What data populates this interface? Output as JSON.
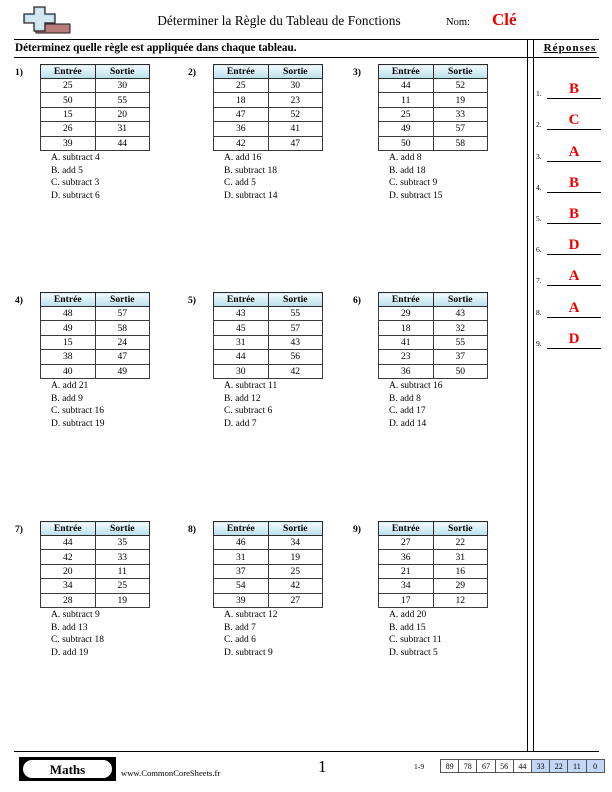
{
  "header": {
    "title": "Déterminer la Règle du Tableau de Fonctions",
    "name_label": "Nom:",
    "name_value": "Clé",
    "name_color": "#ee0000",
    "logo_icon": "plus-and-bar-logo"
  },
  "instruction": "Déterminez quelle règle est appliquée dans chaque tableau.",
  "table_headers": {
    "input": "Entrée",
    "output": "Sortie"
  },
  "questions": [
    {
      "num": "1)",
      "rows": [
        [
          "25",
          "30"
        ],
        [
          "50",
          "55"
        ],
        [
          "15",
          "20"
        ],
        [
          "26",
          "31"
        ],
        [
          "39",
          "44"
        ]
      ],
      "choices": [
        "A. subtract 4",
        "B. add 5",
        "C. subtract 3",
        "D. subtract 6"
      ]
    },
    {
      "num": "2)",
      "rows": [
        [
          "25",
          "30"
        ],
        [
          "18",
          "23"
        ],
        [
          "47",
          "52"
        ],
        [
          "36",
          "41"
        ],
        [
          "42",
          "47"
        ]
      ],
      "choices": [
        "A. add 16",
        "B. subtract 18",
        "C. add 5",
        "D. subtract 14"
      ]
    },
    {
      "num": "3)",
      "rows": [
        [
          "44",
          "52"
        ],
        [
          "11",
          "19"
        ],
        [
          "25",
          "33"
        ],
        [
          "49",
          "57"
        ],
        [
          "50",
          "58"
        ]
      ],
      "choices": [
        "A. add 8",
        "B. add 18",
        "C. subtract 9",
        "D. subtract 15"
      ]
    },
    {
      "num": "4)",
      "rows": [
        [
          "48",
          "57"
        ],
        [
          "49",
          "58"
        ],
        [
          "15",
          "24"
        ],
        [
          "38",
          "47"
        ],
        [
          "40",
          "49"
        ]
      ],
      "choices": [
        "A. add 21",
        "B. add 9",
        "C. subtract 16",
        "D. subtract 19"
      ]
    },
    {
      "num": "5)",
      "rows": [
        [
          "43",
          "55"
        ],
        [
          "45",
          "57"
        ],
        [
          "31",
          "43"
        ],
        [
          "44",
          "56"
        ],
        [
          "30",
          "42"
        ]
      ],
      "choices": [
        "A. subtract 11",
        "B. add 12",
        "C. subtract 6",
        "D. add 7"
      ]
    },
    {
      "num": "6)",
      "rows": [
        [
          "29",
          "43"
        ],
        [
          "18",
          "32"
        ],
        [
          "41",
          "55"
        ],
        [
          "23",
          "37"
        ],
        [
          "36",
          "50"
        ]
      ],
      "choices": [
        "A. subtract 16",
        "B. add 8",
        "C. add 17",
        "D. add 14"
      ]
    },
    {
      "num": "7)",
      "rows": [
        [
          "44",
          "35"
        ],
        [
          "42",
          "33"
        ],
        [
          "20",
          "11"
        ],
        [
          "34",
          "25"
        ],
        [
          "28",
          "19"
        ]
      ],
      "choices": [
        "A. subtract 9",
        "B. add 13",
        "C. subtract 18",
        "D. add 19"
      ]
    },
    {
      "num": "8)",
      "rows": [
        [
          "46",
          "34"
        ],
        [
          "31",
          "19"
        ],
        [
          "37",
          "25"
        ],
        [
          "54",
          "42"
        ],
        [
          "39",
          "27"
        ]
      ],
      "choices": [
        "A. subtract 12",
        "B. add 7",
        "C. add 6",
        "D. subtract 9"
      ]
    },
    {
      "num": "9)",
      "rows": [
        [
          "27",
          "22"
        ],
        [
          "36",
          "31"
        ],
        [
          "21",
          "16"
        ],
        [
          "34",
          "29"
        ],
        [
          "17",
          "12"
        ]
      ],
      "choices": [
        "A. add 20",
        "B. add 15",
        "C. subtract 11",
        "D. subtract 5"
      ]
    }
  ],
  "answers": {
    "title": "Réponses",
    "items": [
      {
        "num": "1.",
        "value": "B"
      },
      {
        "num": "2.",
        "value": "C"
      },
      {
        "num": "3.",
        "value": "A"
      },
      {
        "num": "4.",
        "value": "B"
      },
      {
        "num": "5.",
        "value": "B"
      },
      {
        "num": "6.",
        "value": "D"
      },
      {
        "num": "7.",
        "value": "A"
      },
      {
        "num": "8.",
        "value": "A"
      },
      {
        "num": "9.",
        "value": "D"
      }
    ],
    "value_color": "#ee0000"
  },
  "footer": {
    "brand": "Maths",
    "site": "www.CommonCoreSheets.fr",
    "page_number": "1",
    "score_label": "1-9",
    "score_cells": [
      {
        "value": "89",
        "highlight": false
      },
      {
        "value": "78",
        "highlight": false
      },
      {
        "value": "67",
        "highlight": false
      },
      {
        "value": "56",
        "highlight": false
      },
      {
        "value": "44",
        "highlight": false
      },
      {
        "value": "33",
        "highlight": true
      },
      {
        "value": "22",
        "highlight": true
      },
      {
        "value": "11",
        "highlight": true
      },
      {
        "value": "0",
        "highlight": true
      }
    ],
    "highlight_color": "#c3d6f5"
  }
}
